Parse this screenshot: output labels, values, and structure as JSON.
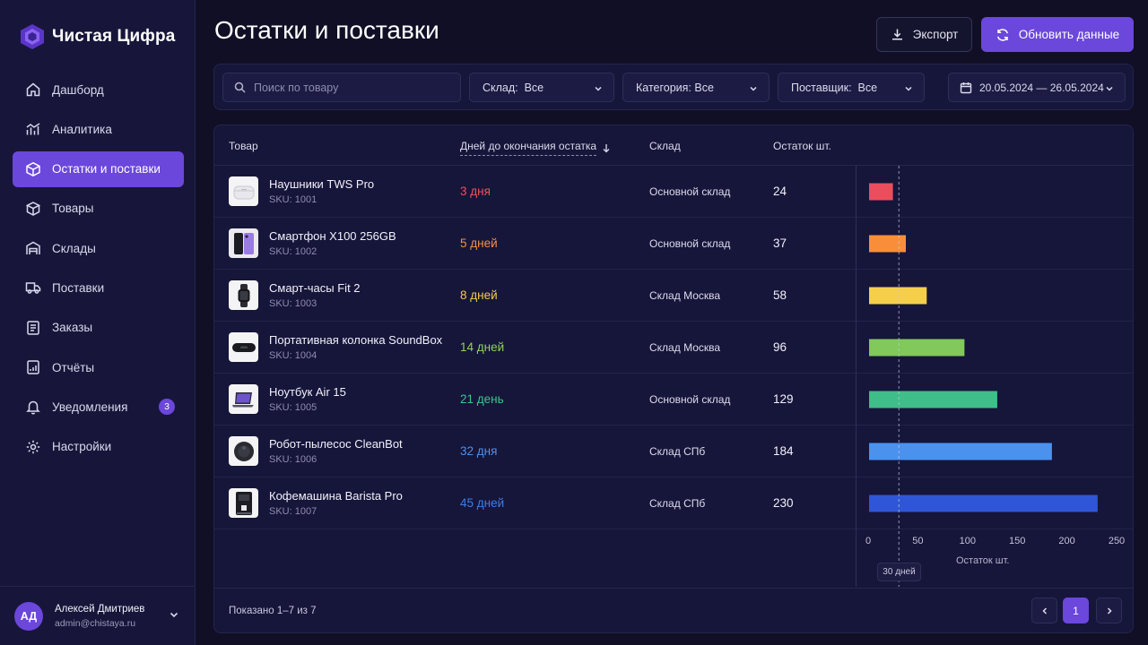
{
  "brand": {
    "name": "Чистая Цифра"
  },
  "nav": [
    {
      "label": "Дашборд",
      "icon": "home-icon"
    },
    {
      "label": "Аналитика",
      "icon": "analytics-icon"
    },
    {
      "label": "Остатки и поставки",
      "icon": "box-icon",
      "active": true
    },
    {
      "label": "Товары",
      "icon": "products-icon"
    },
    {
      "label": "Склады",
      "icon": "warehouse-icon"
    },
    {
      "label": "Поставки",
      "icon": "truck-icon"
    },
    {
      "label": "Заказы",
      "icon": "orders-icon"
    },
    {
      "label": "Отчёты",
      "icon": "report-icon"
    },
    {
      "label": "Уведомления",
      "icon": "bell-icon",
      "badge": "3"
    },
    {
      "label": "Настройки",
      "icon": "gear-icon"
    }
  ],
  "user": {
    "initials": "АД",
    "name": "Алексей Дмитриев",
    "email": "admin@chistaya.ru"
  },
  "header": {
    "title": "Остатки и поставки",
    "export_label": "Экспорт",
    "refresh_label": "Обновить данные"
  },
  "filters": {
    "search_placeholder": "Поиск по товару",
    "warehouse": "Склад:  Все",
    "category": "Категория: Все",
    "supplier": "Поставщик:  Все",
    "date_range": "20.05.2024 — 26.05.2024"
  },
  "table": {
    "col_product": "Товар",
    "col_days": "Дней до окончания остатка",
    "col_warehouse": "Склад",
    "col_qty": "Остаток шт.",
    "rows": [
      {
        "name": "Наушники TWS Pro",
        "sku": "SKU: 1001",
        "days": "3 дня",
        "warehouse": "Основной склад",
        "qty": "24"
      },
      {
        "name": "Смартфон X100 256GB",
        "sku": "SKU: 1002",
        "days": "5 дней",
        "warehouse": "Основной склад",
        "qty": "37"
      },
      {
        "name": "Смарт-часы Fit 2",
        "sku": "SKU: 1003",
        "days": "8 дней",
        "warehouse": "Склад Москва",
        "qty": "58"
      },
      {
        "name": "Портативная колонка SoundBox",
        "sku": "SKU: 1004",
        "days": "14 дней",
        "warehouse": "Склад Москва",
        "qty": "96"
      },
      {
        "name": "Ноутбук Air 15",
        "sku": "SKU: 1005",
        "days": "21 день",
        "warehouse": "Основной склад",
        "qty": "129"
      },
      {
        "name": "Робот-пылесос CleanBot",
        "sku": "SKU: 1006",
        "days": "32 дня",
        "warehouse": "Склад СПб",
        "qty": "184"
      },
      {
        "name": "Кофемашина Barista Pro",
        "sku": "SKU: 1007",
        "days": "45 дней",
        "warehouse": "Склад СПб",
        "qty": "230"
      }
    ],
    "shown_text": "Показано 1–7 из 7",
    "current_page": "1"
  },
  "colors": {
    "accent": "#6b47dc",
    "days": [
      "#f0505f",
      "#f7903d",
      "#f2cc45",
      "#8fd35a",
      "#3fc48c",
      "#4b91ee",
      "#3d7fe6"
    ],
    "bars": [
      "#ec4d5c",
      "#f88e39",
      "#f6cf4a",
      "#80c95a",
      "#3fbe89",
      "#4a92ee",
      "#2f56d6"
    ]
  },
  "chart_data": {
    "type": "bar",
    "orientation": "horizontal",
    "categories": [
      "Наушники TWS Pro",
      "Смартфон X100 256GB",
      "Смарт-часы Fit 2",
      "Портативная колонка SoundBox",
      "Ноутбук Air 15",
      "Робот-пылесос CleanBot",
      "Кофемашина Barista Pro"
    ],
    "values": [
      24,
      37,
      58,
      96,
      129,
      184,
      230
    ],
    "xlabel": "Остаток шт.",
    "xlim": [
      0,
      250
    ],
    "ticks": [
      "0",
      "50",
      "100",
      "150",
      "200",
      "250"
    ],
    "reference_line": {
      "value": 30,
      "label": "30 дней"
    }
  }
}
